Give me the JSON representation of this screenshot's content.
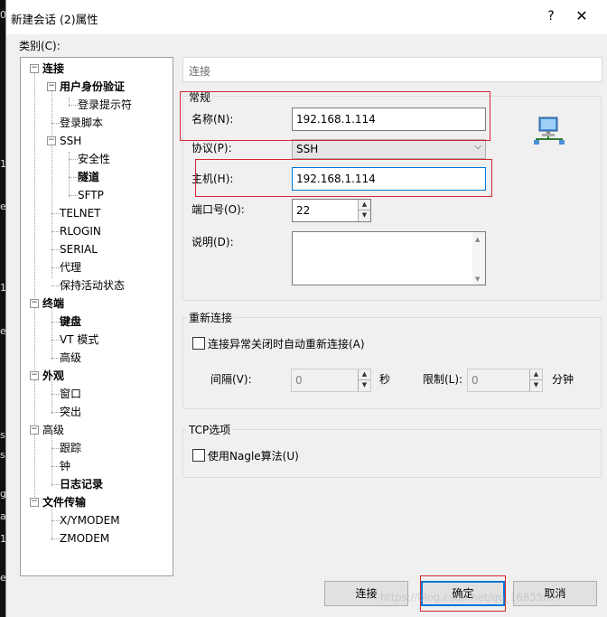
{
  "window": {
    "title": "新建会话 (2)属性",
    "help": "?",
    "close": "✕"
  },
  "category_label": "类别(C):",
  "tree": {
    "connection": "连接",
    "auth": "用户身份验证",
    "login_prompt": "登录提示符",
    "login_script": "登录脚本",
    "ssh": "SSH",
    "security": "安全性",
    "tunnel": "隧道",
    "sftp": "SFTP",
    "telnet": "TELNET",
    "rlogin": "RLOGIN",
    "serial": "SERIAL",
    "proxy": "代理",
    "keepalive": "保持活动状态",
    "terminal": "终端",
    "keyboard": "键盘",
    "vt_mode": "VT 模式",
    "advanced": "高级",
    "appearance": "外观",
    "window": "窗口",
    "highlight": "突出",
    "advanced2": "高级",
    "trace": "跟踪",
    "bell": "钟",
    "logging": "日志记录",
    "file_transfer": "文件传输",
    "xymodem": "X/YMODEM",
    "zmodem": "ZMODEM"
  },
  "breadcrumb": "连接",
  "general": {
    "title": "常规",
    "name_label": "名称(N):",
    "name_value": "192.168.1.114",
    "protocol_label": "协议(P):",
    "protocol_value": "SSH",
    "host_label": "主机(H):",
    "host_value": "192.168.1.114",
    "port_label": "端口号(O):",
    "port_value": "22",
    "desc_label": "说明(D):"
  },
  "reconnect": {
    "title": "重新连接",
    "checkbox_label": "连接异常关闭时自动重新连接(A)",
    "interval_label": "间隔(V):",
    "interval_value": "0",
    "interval_unit": "秒",
    "limit_label": "限制(L):",
    "limit_value": "0",
    "limit_unit": "分钟"
  },
  "tcp": {
    "title": "TCP选项",
    "nagle_label": "使用Nagle算法(U)"
  },
  "buttons": {
    "connect": "连接",
    "ok": "确定",
    "cancel": "取消"
  },
  "watermark": "https://blog.csdn.net/qq_16855077",
  "background_chars": [
    "0",
    "1",
    "e",
    "1",
    "e",
    "s",
    "s",
    "g",
    "a",
    "1",
    "e"
  ],
  "icons": {
    "network": "network-computer-icon"
  },
  "colors": {
    "highlight_red": "#d9252b",
    "focus_blue": "#0078d7"
  }
}
